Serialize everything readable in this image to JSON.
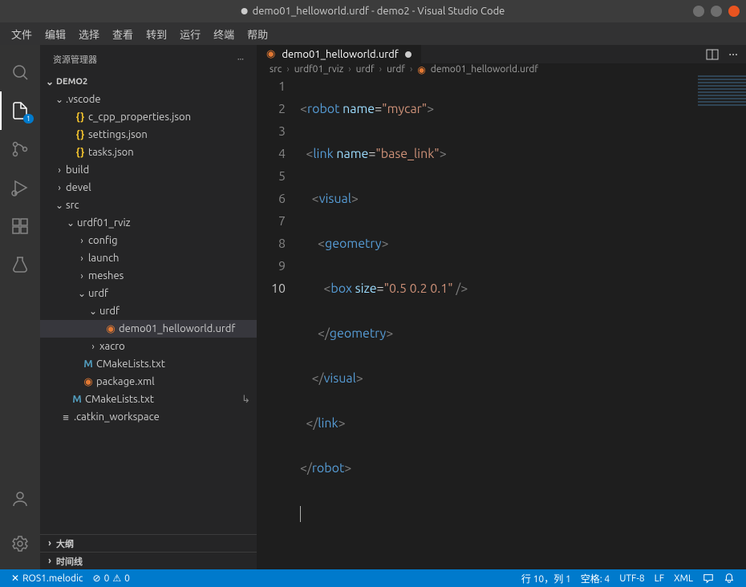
{
  "window": {
    "title": "demo01_helloworld.urdf - demo2 - Visual Studio Code"
  },
  "menu": {
    "items": [
      "文件",
      "编辑",
      "选择",
      "查看",
      "转到",
      "运行",
      "终端",
      "帮助"
    ]
  },
  "activity": {
    "badge": "1"
  },
  "sidebar": {
    "title": "资源管理器",
    "root": "DEMO2",
    "tree": {
      "vscode": ".vscode",
      "ccpp": "c_cpp_properties.json",
      "settings": "settings.json",
      "tasks": "tasks.json",
      "build": "build",
      "devel": "devel",
      "src": "src",
      "urdf01": "urdf01_rviz",
      "config": "config",
      "launch": "launch",
      "meshes": "meshes",
      "urdf_d": "urdf",
      "urdf_d2": "urdf",
      "demo": "demo01_helloworld.urdf",
      "xacro": "xacro",
      "cmake1": "CMakeLists.txt",
      "pkg": "package.xml",
      "cmake2": "CMakeLists.txt",
      "catkin": ".catkin_workspace"
    },
    "outline": "大纲",
    "timeline": "时间线"
  },
  "tab": {
    "label": "demo01_helloworld.urdf"
  },
  "breadcrumb": {
    "p1": "src",
    "p2": "urdf01_rviz",
    "p3": "urdf",
    "p4": "urdf",
    "p5": "demo01_helloworld.urdf"
  },
  "code": {
    "l1": {
      "tag": "robot",
      "attr": "name",
      "val": "\"mycar\""
    },
    "l2": {
      "tag": "link",
      "attr": "name",
      "val": "\"base_link\""
    },
    "l3": {
      "tag": "visual"
    },
    "l4": {
      "tag": "geometry"
    },
    "l5": {
      "tag": "box",
      "attr": "size",
      "val": "\"0.5 0.2 0.1\""
    },
    "l6": {
      "tag": "geometry"
    },
    "l7": {
      "tag": "visual"
    },
    "l8": {
      "tag": "link"
    },
    "l9": {
      "tag": "robot"
    }
  },
  "status": {
    "ros": "ROS1.melodic",
    "errors": "0",
    "warnings": "0",
    "pos": "行 10，列 1",
    "spaces": "空格: 4",
    "enc": "UTF-8",
    "eol": "LF",
    "lang": "XML"
  }
}
